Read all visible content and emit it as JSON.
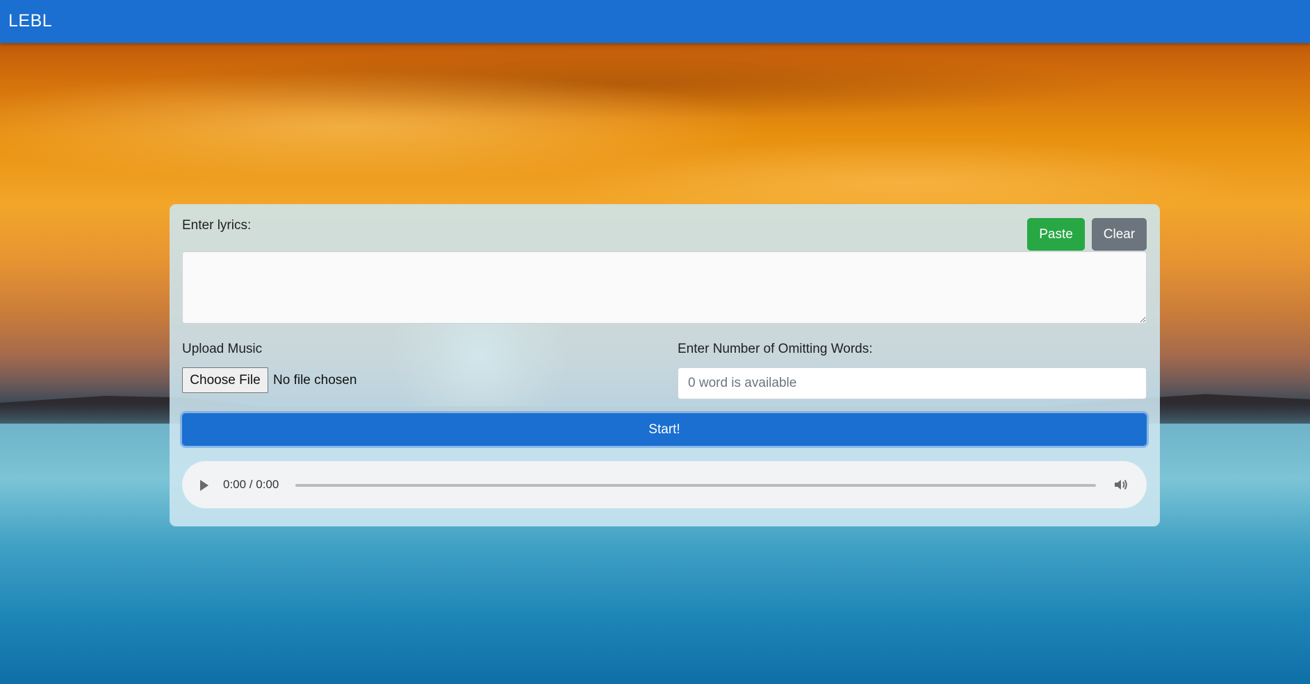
{
  "navbar": {
    "brand": "LEBL"
  },
  "form": {
    "lyrics_label": "Enter lyrics:",
    "paste_label": "Paste",
    "clear_label": "Clear",
    "lyrics_value": "",
    "upload_label": "Upload Music",
    "choose_file_label": "Choose File",
    "file_status": "No file chosen",
    "omit_label": "Enter Number of Omitting Words:",
    "omit_placeholder": "0 word is available",
    "start_label": "Start!"
  },
  "audio": {
    "time": "0:00 / 0:00",
    "progress": 0,
    "play_icon": "play-icon",
    "volume_icon": "volume-icon"
  },
  "colors": {
    "navbar": "#1a6fd0",
    "paste": "#28a745",
    "clear": "#6c757d",
    "start": "#1a6fd0"
  }
}
